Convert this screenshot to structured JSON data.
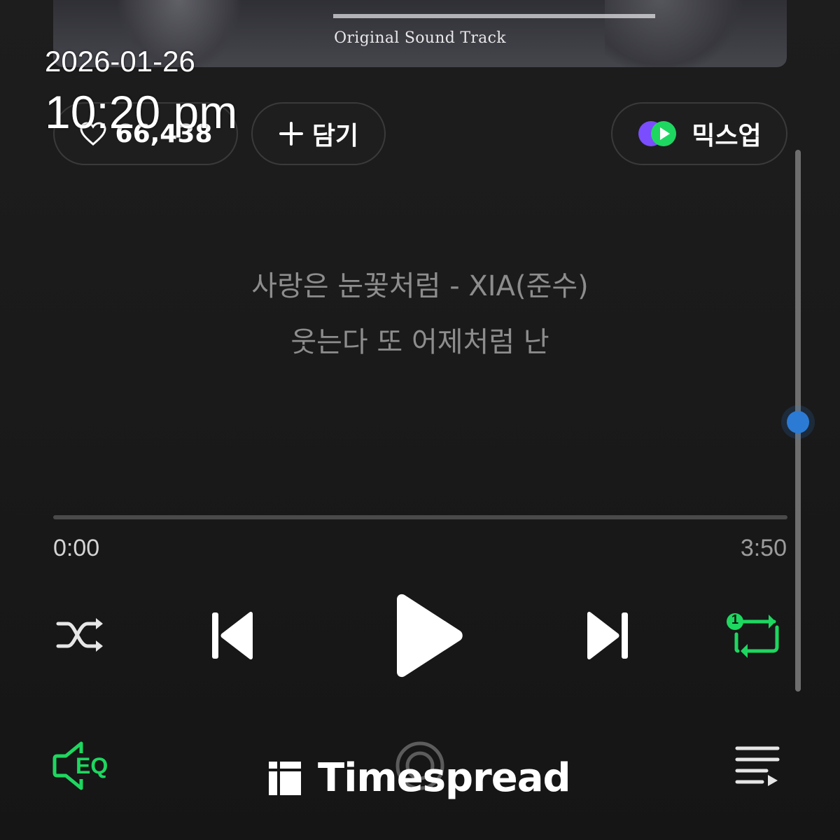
{
  "album": {
    "subtitle": "Original Sound Track"
  },
  "overlay": {
    "date": "2026-01-26",
    "time": "10:20 pm"
  },
  "actions": {
    "like_count": "66,438",
    "add_label": "담기",
    "mixup_label": "믹스업"
  },
  "lyrics": {
    "line1": "사랑은 눈꽃처럼 - XIA(준수)",
    "line2": "웃는다 또 어제처럼 난"
  },
  "progress": {
    "elapsed": "0:00",
    "total": "3:50",
    "fraction": 0
  },
  "controls": {
    "shuffle_icon": "shuffle-icon",
    "prev_icon": "skip-previous-icon",
    "play_icon": "play-icon",
    "next_icon": "skip-next-icon",
    "repeat_icon": "repeat-one-icon",
    "repeat_badge": "1",
    "eq_icon": "equalizer-icon",
    "eq_label": "EQ",
    "center_icon": "target-icon",
    "queue_icon": "playlist-icon"
  },
  "watermark": {
    "text": "Timespread"
  },
  "colors": {
    "accent_green": "#1ed760",
    "background": "#1c1c1c",
    "scroll_thumb": "#2b7bd4",
    "lyric": "#8d8d8d"
  }
}
